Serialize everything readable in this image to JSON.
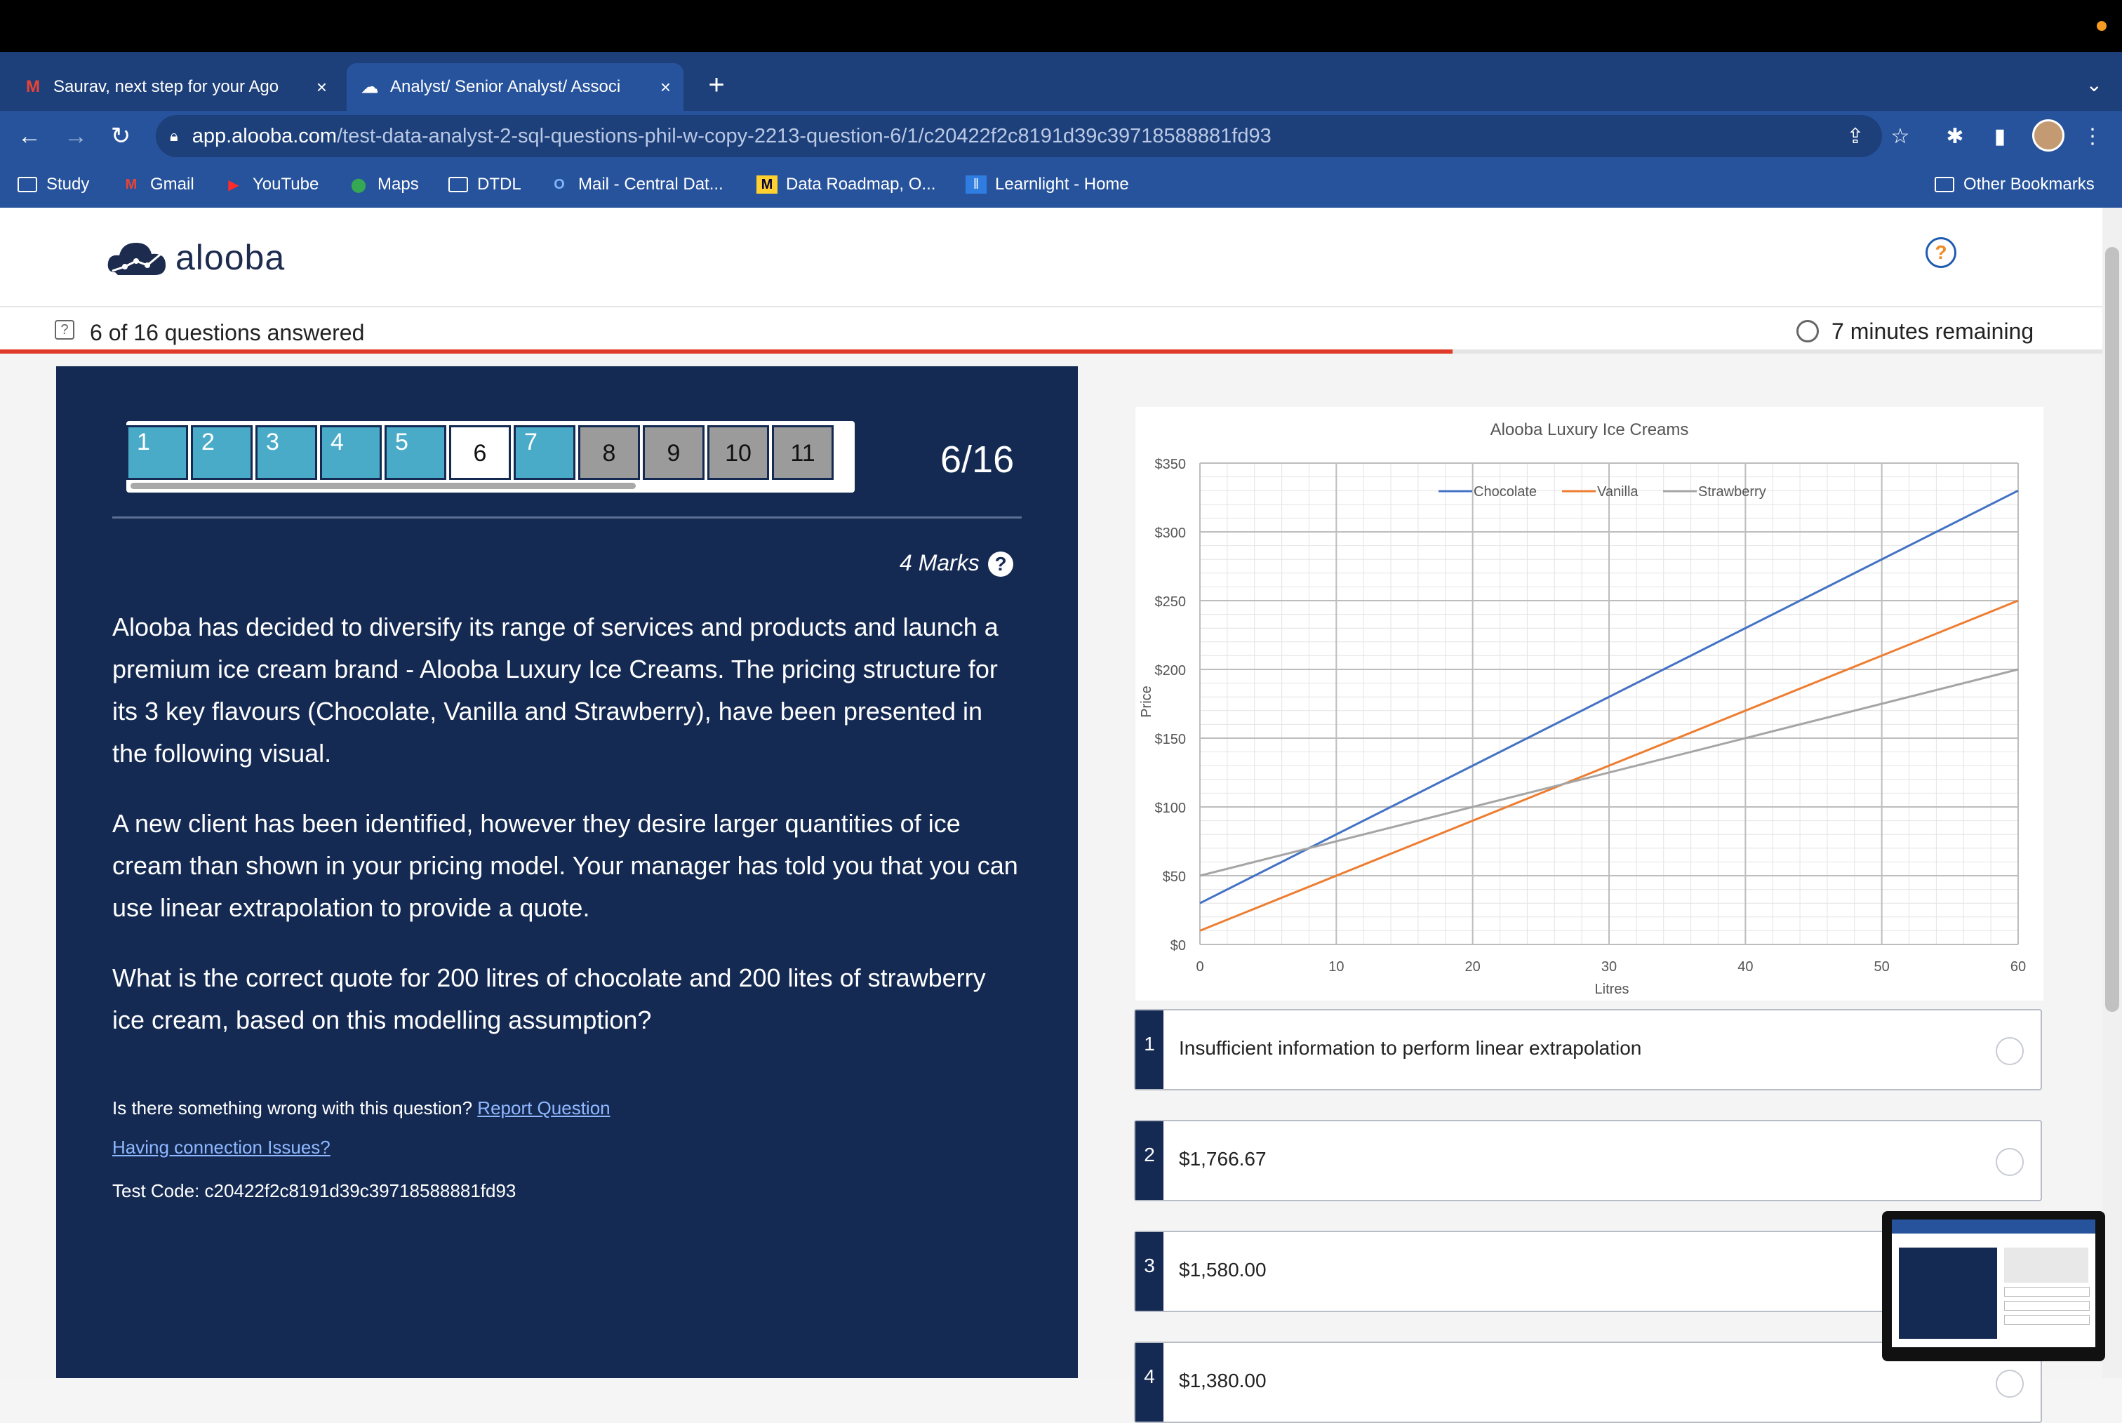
{
  "browser": {
    "tabs": [
      {
        "title": "Saurav, next step for your Ago",
        "icon": "gmail-icon",
        "active": false
      },
      {
        "title": "Analyst/ Senior Analyst/ Associ",
        "icon": "alooba-icon",
        "active": true
      }
    ],
    "url_domain": "app.alooba.com",
    "url_path": "/test-data-analyst-2-sql-questions-phil-w-copy-2213-question-6/1/c20422f2c8191d39c39718588881fd93",
    "bookmarks": [
      "Study",
      "Gmail",
      "YouTube",
      "Maps",
      "DTDL",
      "Mail - Central Dat...",
      "Data Roadmap, O...",
      "Learnlight - Home"
    ],
    "other_bookmarks": "Other Bookmarks"
  },
  "header": {
    "logo_text": "alooba",
    "help_label": "?"
  },
  "progress": {
    "answered_text": "6 of 16 questions answered",
    "remaining_text": "7 minutes remaining",
    "fraction": 0.375
  },
  "question": {
    "nav_numbers": [
      "1",
      "2",
      "3",
      "4",
      "5",
      "6",
      "7",
      "8",
      "9",
      "10",
      "11"
    ],
    "current": 6,
    "counter": "6/16",
    "marks": "4 Marks",
    "paragraphs": [
      "Alooba has decided to diversify its range of services and products and launch a premium ice cream brand - Alooba Luxury Ice Creams. The pricing structure for its 3 key flavours (Chocolate, Vanilla and Strawberry), have been presented in the following visual.",
      "A new client has been identified, however they desire larger quantities of ice cream than shown in your pricing model. Your manager has told you that you can use linear extrapolation to provide a quote.",
      "What is the correct quote for 200 litres of chocolate and 200 lites of strawberry ice cream, based on this modelling assumption?"
    ],
    "report_prefix": "Is there something wrong with this question?",
    "report_link": "Report Question",
    "connection_link": "Having connection Issues?",
    "test_code": "Test Code: c20422f2c8191d39c39718588881fd93"
  },
  "options": [
    {
      "num": "1",
      "text": "Insufficient information to perform linear extrapolation"
    },
    {
      "num": "2",
      "text": "$1,766.67"
    },
    {
      "num": "3",
      "text": "$1,580.00"
    },
    {
      "num": "4",
      "text": "$1,380.00"
    }
  ],
  "chart_data": {
    "type": "line",
    "title": "Alooba Luxury Ice Creams",
    "xlabel": "Litres",
    "ylabel": "Price",
    "xlim": [
      0,
      60
    ],
    "ylim": [
      0,
      350
    ],
    "x_ticks": [
      "0",
      "10",
      "20",
      "30",
      "40",
      "50",
      "60"
    ],
    "y_ticks": [
      "$0",
      "$50",
      "$100",
      "$150",
      "$200",
      "$250",
      "$300",
      "$350"
    ],
    "grid": true,
    "legend": "top-center",
    "series": [
      {
        "name": "Chocolate",
        "color": "#4472c4",
        "x": [
          0,
          60
        ],
        "y": [
          30,
          330
        ]
      },
      {
        "name": "Vanilla",
        "color": "#ed7d31",
        "x": [
          0,
          60
        ],
        "y": [
          10,
          250
        ]
      },
      {
        "name": "Strawberry",
        "color": "#a5a5a5",
        "x": [
          0,
          60
        ],
        "y": [
          50,
          200
        ]
      }
    ]
  }
}
